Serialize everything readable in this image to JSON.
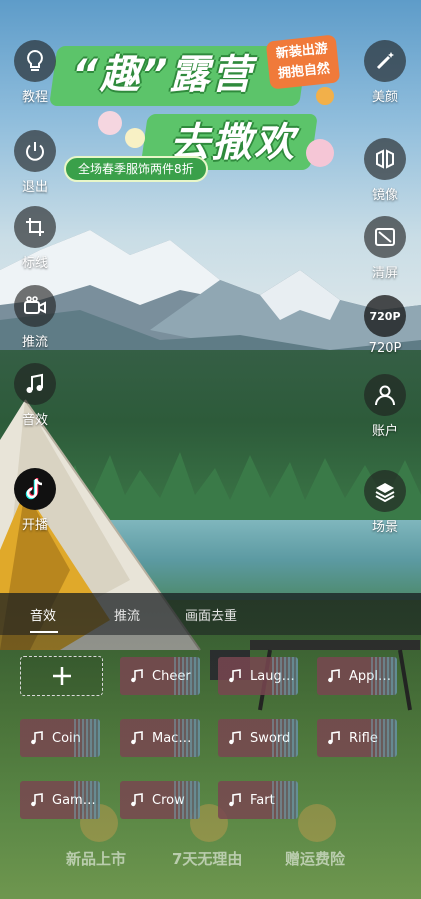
{
  "promo": {
    "title_line1": "“趣”露营",
    "title_line2": "去撒欢",
    "badge_line1": "新装出游",
    "badge_line2": "拥抱自然",
    "subtitle": "全场春季服饰两件8折"
  },
  "left_controls": [
    {
      "label": "教程",
      "icon": "lightbulb-icon"
    },
    {
      "label": "退出",
      "icon": "power-icon"
    },
    {
      "label": "标线",
      "icon": "crop-grid-icon"
    },
    {
      "label": "推流",
      "icon": "video-camera-icon"
    },
    {
      "label": "音效",
      "icon": "music-note-icon"
    },
    {
      "label": "开播",
      "icon": "tiktok-icon"
    }
  ],
  "right_controls": [
    {
      "label": "美颜",
      "icon": "magic-wand-icon"
    },
    {
      "label": "镜像",
      "icon": "mirror-icon"
    },
    {
      "label": "清屏",
      "icon": "clear-screen-icon"
    },
    {
      "label": "720P",
      "icon": "resolution-icon",
      "icon_text": "720P"
    },
    {
      "label": "账户",
      "icon": "user-icon"
    },
    {
      "label": "场景",
      "icon": "layers-icon"
    }
  ],
  "tabs": [
    {
      "label": "音效",
      "active": true
    },
    {
      "label": "推流",
      "active": false
    },
    {
      "label": "画面去重",
      "active": false
    }
  ],
  "sound_effects": [
    "Cheer",
    "Laug…",
    "Appl…",
    "Coin",
    "Mac…",
    "Sword",
    "Rifle",
    "Gam…",
    "Crow",
    "Fart"
  ],
  "background_tags": [
    "新品上市",
    "7天无理由",
    "赠运费险"
  ],
  "colors": {
    "panel_bg": "rgba(25,30,32,0.55)",
    "sfx_tile": "#78465",
    "promo_green": "#3aa04a",
    "promo_orange": "#f07a3a"
  }
}
